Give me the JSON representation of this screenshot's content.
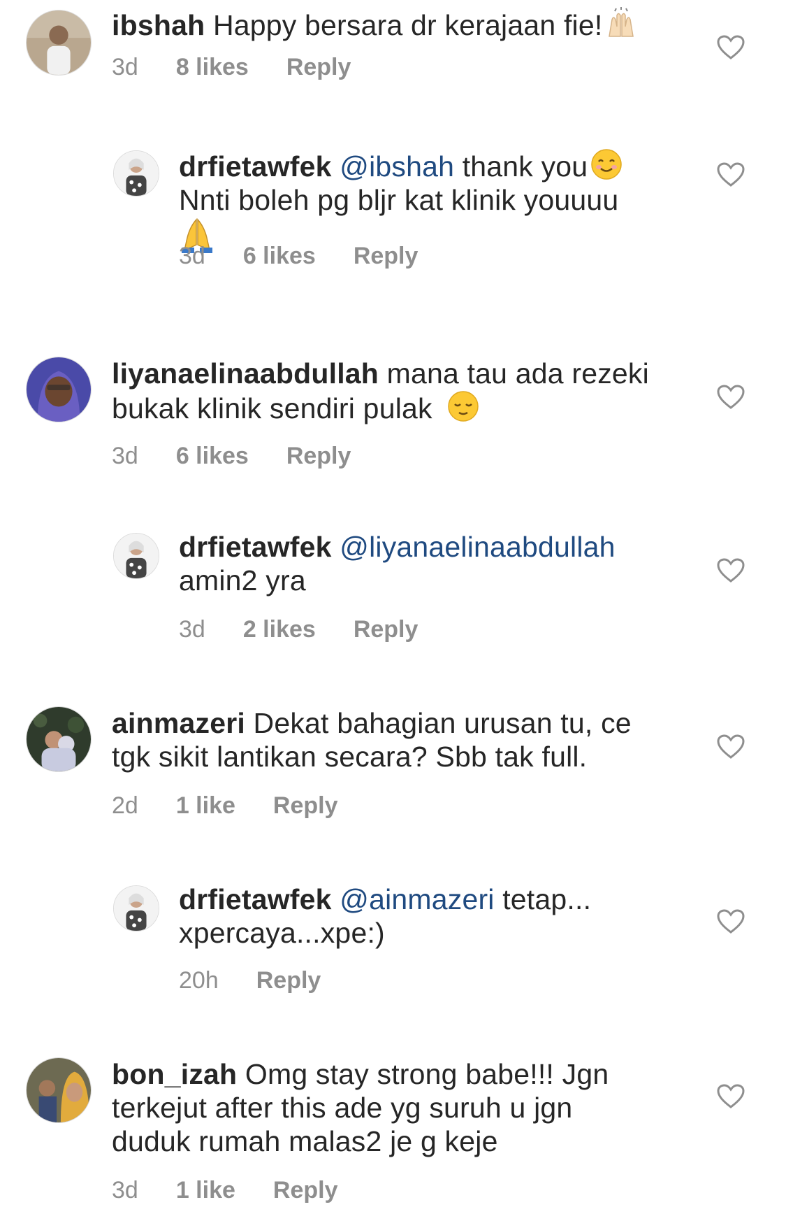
{
  "comments": [
    {
      "user": "ibshah",
      "text": "Happy bersara dr kerajaan fie!",
      "emoji": "raising-hands-emoji",
      "time": "3d",
      "likes": "8 likes",
      "reply": "Reply"
    },
    {
      "user": "drfietawfek",
      "mention": "@ibshah",
      "text": "thank you",
      "emoji": "smiling-face-emoji",
      "text2": "Nnti boleh pg bljr kat klinik youuuu",
      "emoji2": "folded-hands-emoji",
      "time": "3d",
      "likes": "6 likes",
      "reply": "Reply"
    },
    {
      "user": "liyanaelinaabdullah",
      "text": "mana tau ada rezeki bukak klinik sendiri pulak",
      "emoji": "relieved-face-emoji",
      "time": "3d",
      "likes": "6 likes",
      "reply": "Reply"
    },
    {
      "user": "drfietawfek",
      "mention": "@liyanaelinaabdullah",
      "text": "amin2 yra",
      "time": "3d",
      "likes": "2 likes",
      "reply": "Reply"
    },
    {
      "user": "ainmazeri",
      "text": "Dekat bahagian urusan tu, ce tgk sikit lantikan secara? Sbb tak full.",
      "time": "2d",
      "likes": "1 like",
      "reply": "Reply"
    },
    {
      "user": "drfietawfek",
      "mention": "@ainmazeri",
      "text": "tetap... xpercaya...xpe:)",
      "time": "20h",
      "reply": "Reply"
    },
    {
      "user": "bon_izah",
      "text": "Omg stay strong babe!!! Jgn terkejut after this ade yg suruh u jgn duduk rumah malas2 je g keje",
      "time": "3d",
      "likes": "1 like",
      "reply": "Reply"
    }
  ],
  "colors": {
    "text": "#262626",
    "meta": "#8e8e8e",
    "mention": "#1f4a80"
  },
  "icons": {
    "like": "heart-outline-icon"
  }
}
